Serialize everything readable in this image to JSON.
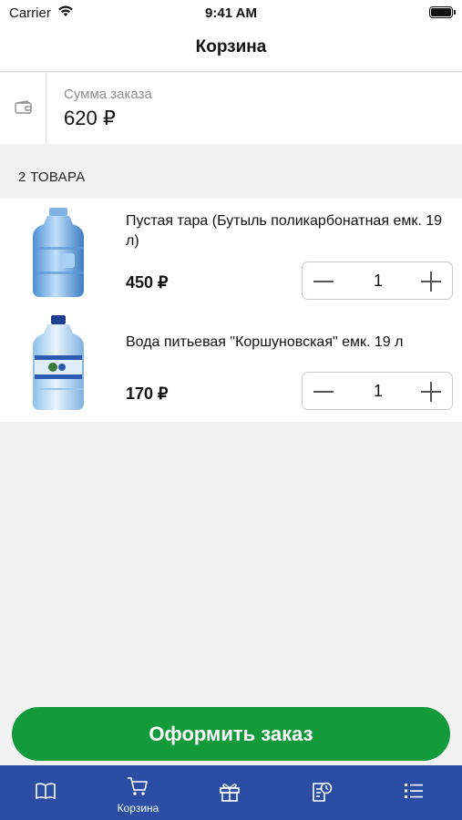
{
  "status_bar": {
    "carrier": "Carrier",
    "time": "9:41 AM"
  },
  "nav": {
    "title": "Корзина"
  },
  "summary": {
    "label": "Сумма заказа",
    "value": "620 ₽",
    "icon": "wallet-icon"
  },
  "section": {
    "header": "2 ТОВАРА"
  },
  "items": [
    {
      "name": "Пустая тара (Бутыль поликарбонатная емк. 19 л)",
      "price": "450 ₽",
      "quantity": "1",
      "image": "empty-water-bottle"
    },
    {
      "name": "Вода питьевая \"Коршуновская\" емк. 19 л",
      "price": "170 ₽",
      "quantity": "1",
      "image": "water-bottle-with-label"
    }
  ],
  "checkout": {
    "label": "Оформить заказ"
  },
  "tabs": [
    {
      "icon": "book-icon",
      "label": ""
    },
    {
      "icon": "cart-icon",
      "label": "Корзина",
      "active": true
    },
    {
      "icon": "gift-icon",
      "label": ""
    },
    {
      "icon": "order-history-icon",
      "label": ""
    },
    {
      "icon": "list-icon",
      "label": ""
    }
  ],
  "colors": {
    "accent_green": "#139a3b",
    "tab_bar": "#2b4da4",
    "background": "#f2f2f2"
  }
}
